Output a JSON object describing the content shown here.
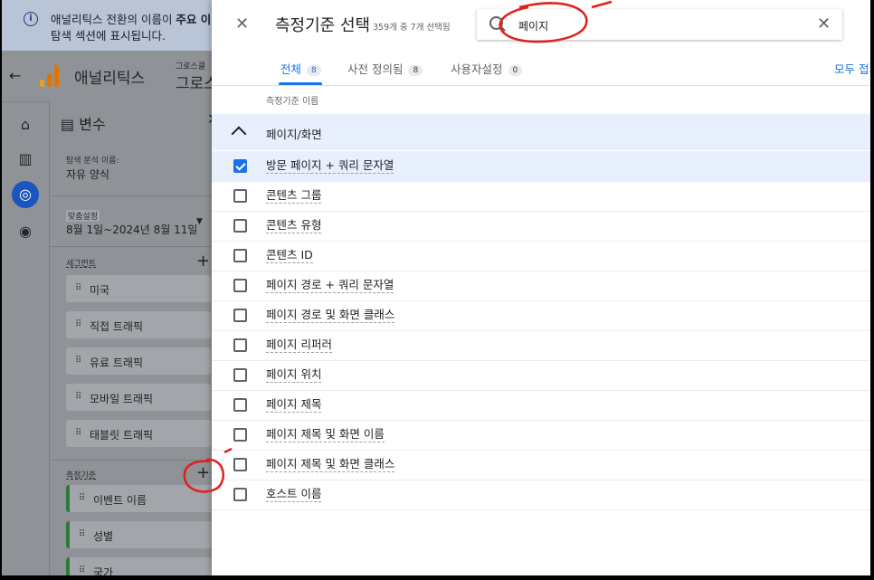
{
  "banner": {
    "text_line1_prefix": "애널리틱스 전환의 이름이 ",
    "text_line1_bold": "주요 이",
    "text_line2": "탐색 섹션에 표시됩니다."
  },
  "appbar": {
    "app_name": "애널리틱스",
    "account_small": "그로스클",
    "account_big": "그로스"
  },
  "variables": {
    "title": "변수",
    "analysis_name_label": "탐색 분석 이름:",
    "analysis_name_value": "자유 양식",
    "date_label": "맞춤설정",
    "date_value": "8월 1일~2024년 8월 11일",
    "segments_label": "세그먼트",
    "segments": [
      "미국",
      "직접 트래픽",
      "유료 트래픽",
      "모바일 트래픽",
      "태블릿 트래픽"
    ],
    "metrics_label": "측정기준",
    "metrics": [
      "이벤트 이름",
      "성별",
      "국가"
    ]
  },
  "panel": {
    "title": "측정기준 선택",
    "selected_count": "359개 중 7개 선택됨",
    "search_value": "페이지",
    "tabs": [
      {
        "label": "전체",
        "count": "8"
      },
      {
        "label": "사전 정의됨",
        "count": "8"
      },
      {
        "label": "사용자설정",
        "count": "0"
      }
    ],
    "collapse_all": "모두 접기",
    "column_header": "측정기준 이름",
    "group": "페이지/화면",
    "rows": [
      {
        "label": "방문 페이지 + 쿼리 문자열",
        "checked": true
      },
      {
        "label": "콘텐츠 그룹",
        "checked": false
      },
      {
        "label": "콘텐츠 유형",
        "checked": false
      },
      {
        "label": "콘텐츠 ID",
        "checked": false
      },
      {
        "label": "페이지 경로 + 쿼리 문자열",
        "checked": false
      },
      {
        "label": "페이지 경로 및 화면 클래스",
        "checked": false
      },
      {
        "label": "페이지 리퍼러",
        "checked": false
      },
      {
        "label": "페이지 위치",
        "checked": false
      },
      {
        "label": "페이지 제목",
        "checked": false
      },
      {
        "label": "페이지 제목 및 화면 이름",
        "checked": false
      },
      {
        "label": "페이지 제목 및 화면 클래스",
        "checked": false
      },
      {
        "label": "호스트 이름",
        "checked": false
      }
    ]
  },
  "colors": {
    "accent": "#1a73e8",
    "selected_row": "#e8f0fe",
    "annotation": "#e0201c"
  }
}
